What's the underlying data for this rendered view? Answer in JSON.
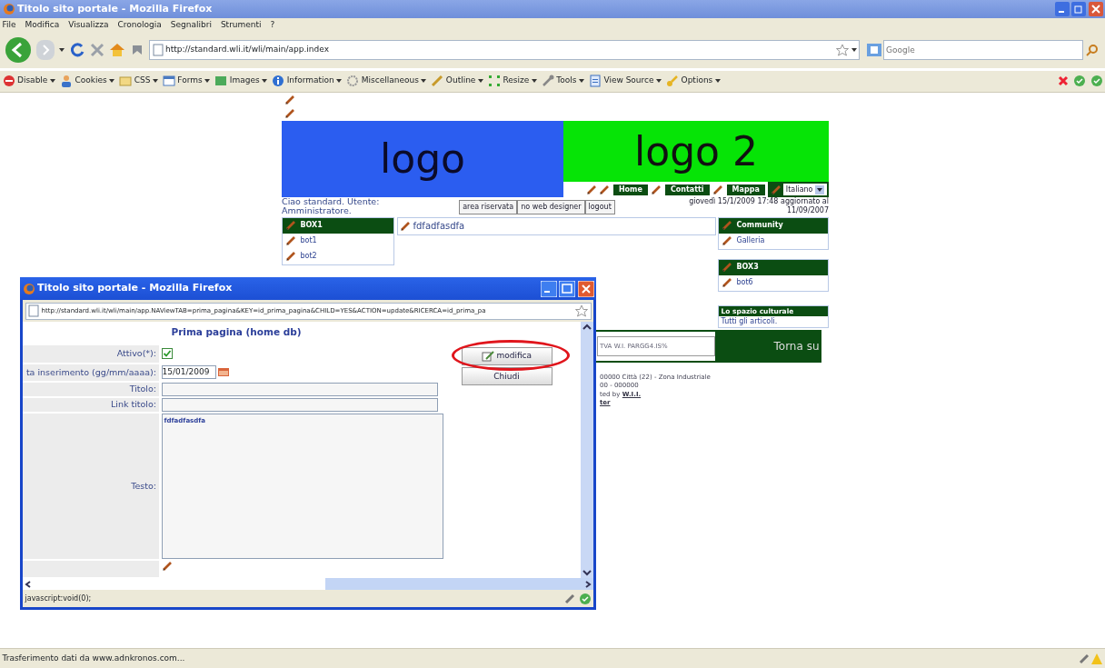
{
  "browser": {
    "title": "Titolo sito portale - Mozilla Firefox",
    "menu": [
      "File",
      "Modifica",
      "Visualizza",
      "Cronologia",
      "Segnalibri",
      "Strumenti",
      "?"
    ],
    "url": "http://standard.wli.it/wli/main/app.index",
    "search_placeholder": "Google",
    "toolbar": [
      {
        "label": "Disable"
      },
      {
        "label": "Cookies"
      },
      {
        "label": "CSS"
      },
      {
        "label": "Forms"
      },
      {
        "label": "Images"
      },
      {
        "label": "Information"
      },
      {
        "label": "Miscellaneous"
      },
      {
        "label": "Outline"
      },
      {
        "label": "Resize"
      },
      {
        "label": "Tools"
      },
      {
        "label": "View Source"
      },
      {
        "label": "Options"
      }
    ],
    "status": "Trasferimento dati da www.adnkronos.com..."
  },
  "page": {
    "logo": "logo",
    "logo2": "logo 2",
    "nav": [
      "Home",
      "Contatti",
      "Mappa"
    ],
    "language": "Italiano",
    "greeting": "Ciao standard. Utente: Amministratore.",
    "buttons": [
      "area riservata",
      "no web designer",
      "logout"
    ],
    "date": "giovedì 15/1/2009 17:48 aggiornato al 11/09/2007",
    "left_box": {
      "title": "BOX1",
      "items": [
        "bot1",
        "bot2"
      ]
    },
    "headline": "fdfadfasdfa",
    "right_boxes": [
      {
        "title": "Community",
        "items": [
          "Galleria"
        ]
      },
      {
        "title": "BOX3",
        "items": [
          "bot6"
        ]
      }
    ],
    "culture_box": {
      "title": "Lo spazio culturale",
      "link": "Tutti gli articoli."
    },
    "footer_field": "TVA W.I. PARGG4.IS%",
    "back_to_top": "Torna su",
    "address": "00000 Città (22) - Zona Industriale",
    "phone": "00 - 000000",
    "credit": "ted by",
    "credit_link": "W.I.I.",
    "footer_link": "ter"
  },
  "popup": {
    "title": "Titolo sito portale - Mozilla Firefox",
    "url": "http://standard.wli.it/wli/main/app.NAViewTAB=prima_pagina&KEY=id_prima_pagina&CHILD=YES&ACTION=update&RICERCA=id_prima_pa",
    "heading": "Prima pagina (home db)",
    "fields": [
      {
        "kind": "checkbox",
        "label": "Attivo(*):",
        "checked": true
      },
      {
        "kind": "date",
        "label": "ta inserimento (gg/mm/aaaa):",
        "value": "15/01/2009"
      },
      {
        "kind": "text",
        "label": "Titolo:"
      },
      {
        "kind": "text",
        "label": "Link titolo:"
      },
      {
        "kind": "textarea",
        "label": "Testo:",
        "value": "fdfadfasdfa"
      }
    ],
    "buttons": [
      {
        "label": "modifica",
        "highlighted": true
      },
      {
        "label": "Chiudi",
        "highlighted": false
      }
    ],
    "status": "javascript:void(0);"
  }
}
